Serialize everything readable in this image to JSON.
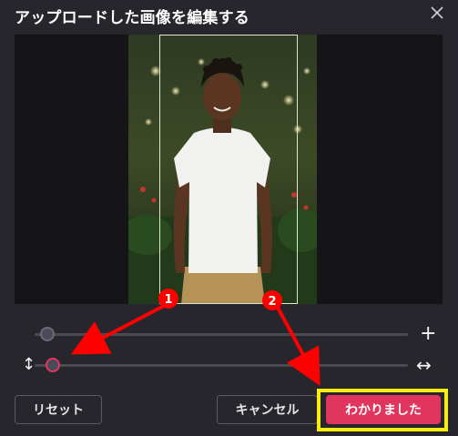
{
  "dialog": {
    "title": "アップロードした画像を編集する",
    "close_icon": "close-icon"
  },
  "sliders": {
    "zoom": {
      "plus_icon": "+",
      "value": 0.02
    },
    "aspect": {
      "vertical_icon": "↕",
      "horizontal_icon": "↔",
      "value": 0.03
    }
  },
  "buttons": {
    "reset": "リセット",
    "cancel": "キャンセル",
    "confirm": "わかりました"
  },
  "annotations": {
    "badge_1": "1",
    "badge_2": "2",
    "arrow_color": "#ff0000",
    "highlight_color": "#f5ee10"
  },
  "colors": {
    "accent": "#e0365e",
    "background": "#26262c"
  }
}
